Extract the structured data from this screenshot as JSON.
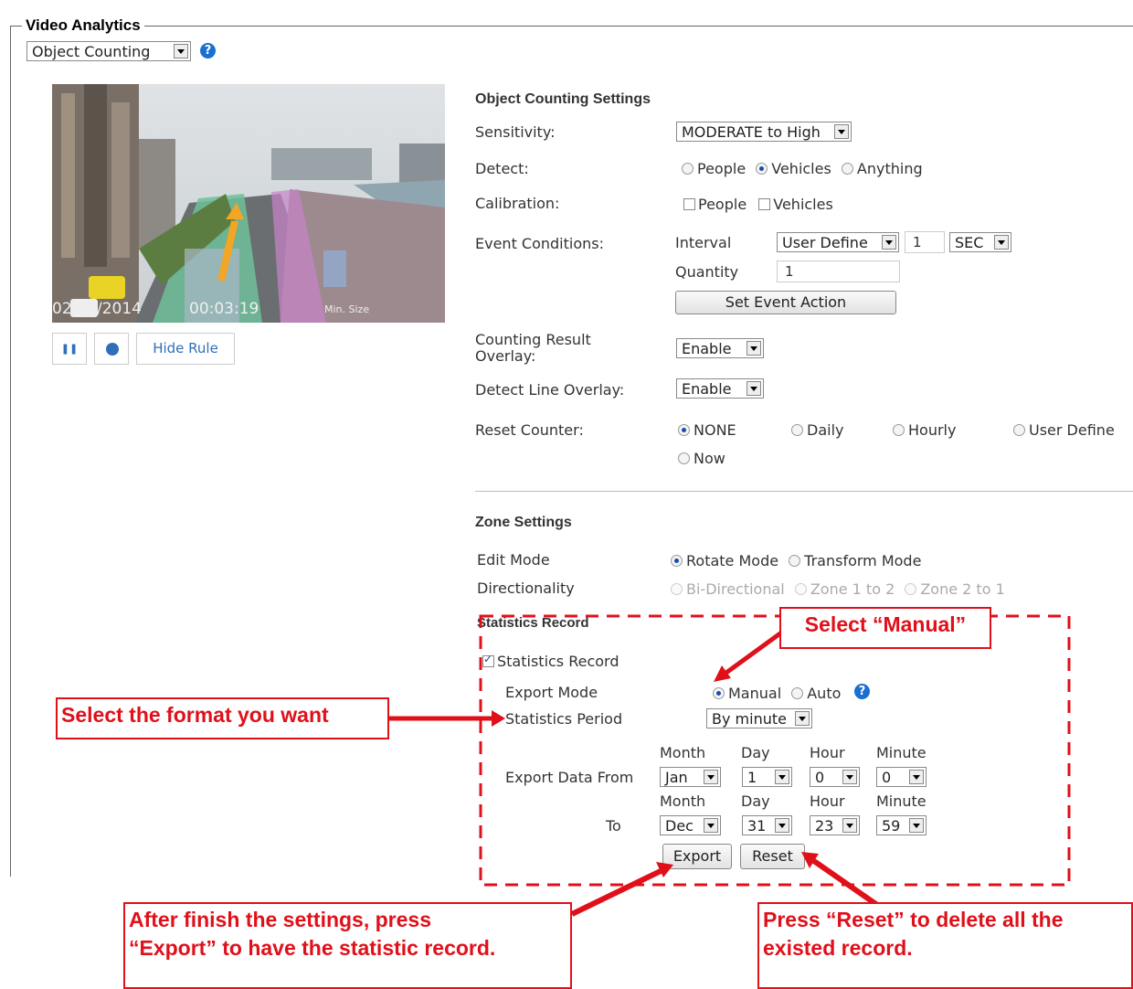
{
  "section_title": "Video Analytics",
  "mode_select": "Object Counting",
  "video": {
    "timestamp": "02/22/2014",
    "time": "00:03:19",
    "min_size_label": "Min. Size",
    "hide_rule_label": "Hide Rule"
  },
  "settings": {
    "heading": "Object Counting Settings",
    "sensitivity_label": "Sensitivity:",
    "sensitivity_value": "MODERATE to High",
    "detect_label": "Detect:",
    "detect_options": [
      "People",
      "Vehicles",
      "Anything"
    ],
    "calibration_label": "Calibration:",
    "calibration_options": [
      "People",
      "Vehicles"
    ],
    "event_label": "Event Conditions:",
    "interval_label": "Interval",
    "interval_mode": "User Define",
    "interval_value": "1",
    "interval_unit": "SEC",
    "quantity_label": "Quantity",
    "quantity_value": "1",
    "set_event_label": "Set Event Action",
    "overlay_label_1": "Counting Result",
    "overlay_label_2": "Overlay:",
    "overlay_value": "Enable",
    "detect_line_label": "Detect Line Overlay:",
    "detect_line_value": "Enable",
    "reset_label": "Reset Counter:",
    "reset_options": [
      "NONE",
      "Daily",
      "Hourly",
      "User Define",
      "Now"
    ]
  },
  "zone": {
    "heading": "Zone Settings",
    "edit_mode_label": "Edit Mode",
    "edit_options": [
      "Rotate Mode",
      "Transform Mode"
    ],
    "direction_label": "Directionality",
    "direction_options": [
      "Bi-Directional",
      "Zone 1 to 2",
      "Zone 2 to 1"
    ]
  },
  "stats": {
    "heading": "Statistics Record",
    "checkbox_label": "Statistics Record",
    "export_mode_label": "Export Mode",
    "export_options": [
      "Manual",
      "Auto"
    ],
    "period_label": "Statistics Period",
    "period_value": "By minute",
    "export_from_label": "Export Data  From",
    "to_label": "To",
    "col_month": "Month",
    "col_day": "Day",
    "col_hour": "Hour",
    "col_minute": "Minute",
    "from": {
      "month": "Jan",
      "day": "1",
      "hour": "0",
      "minute": "0"
    },
    "to": {
      "month": "Dec",
      "day": "31",
      "hour": "23",
      "minute": "59"
    },
    "export_btn": "Export",
    "reset_btn": "Reset"
  },
  "annotations": {
    "manual": "Select “Manual”",
    "format": "Select the format you want",
    "export_1": "After finish the settings, press",
    "export_2": "“Export” to have the statistic record.",
    "reset_1": "Press “Reset” to delete all the",
    "reset_2": "existed record."
  },
  "colors": {
    "annotation": "#e0101a",
    "help_icon": "#1a6fd0"
  }
}
